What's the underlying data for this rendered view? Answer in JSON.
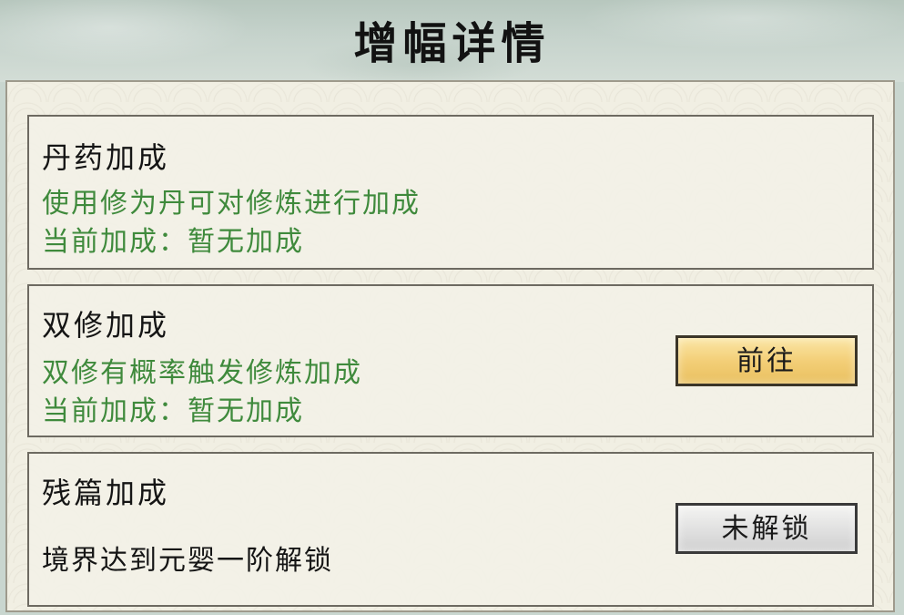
{
  "page": {
    "title": "增幅详情"
  },
  "cards": [
    {
      "title": "丹药加成",
      "description": "使用修为丹可对修炼进行加成",
      "status": "当前加成：暂无加成"
    },
    {
      "title": "双修加成",
      "description": "双修有概率触发修炼加成",
      "status": "当前加成：暂无加成",
      "button_label": "前往"
    },
    {
      "title": "残篇加成",
      "requirement": "境界达到元婴一阶解锁",
      "button_label": "未解锁"
    }
  ],
  "colors": {
    "accent_green": "#3f8a3c",
    "button_gold": "#f3cf78",
    "button_locked": "#dedede"
  }
}
